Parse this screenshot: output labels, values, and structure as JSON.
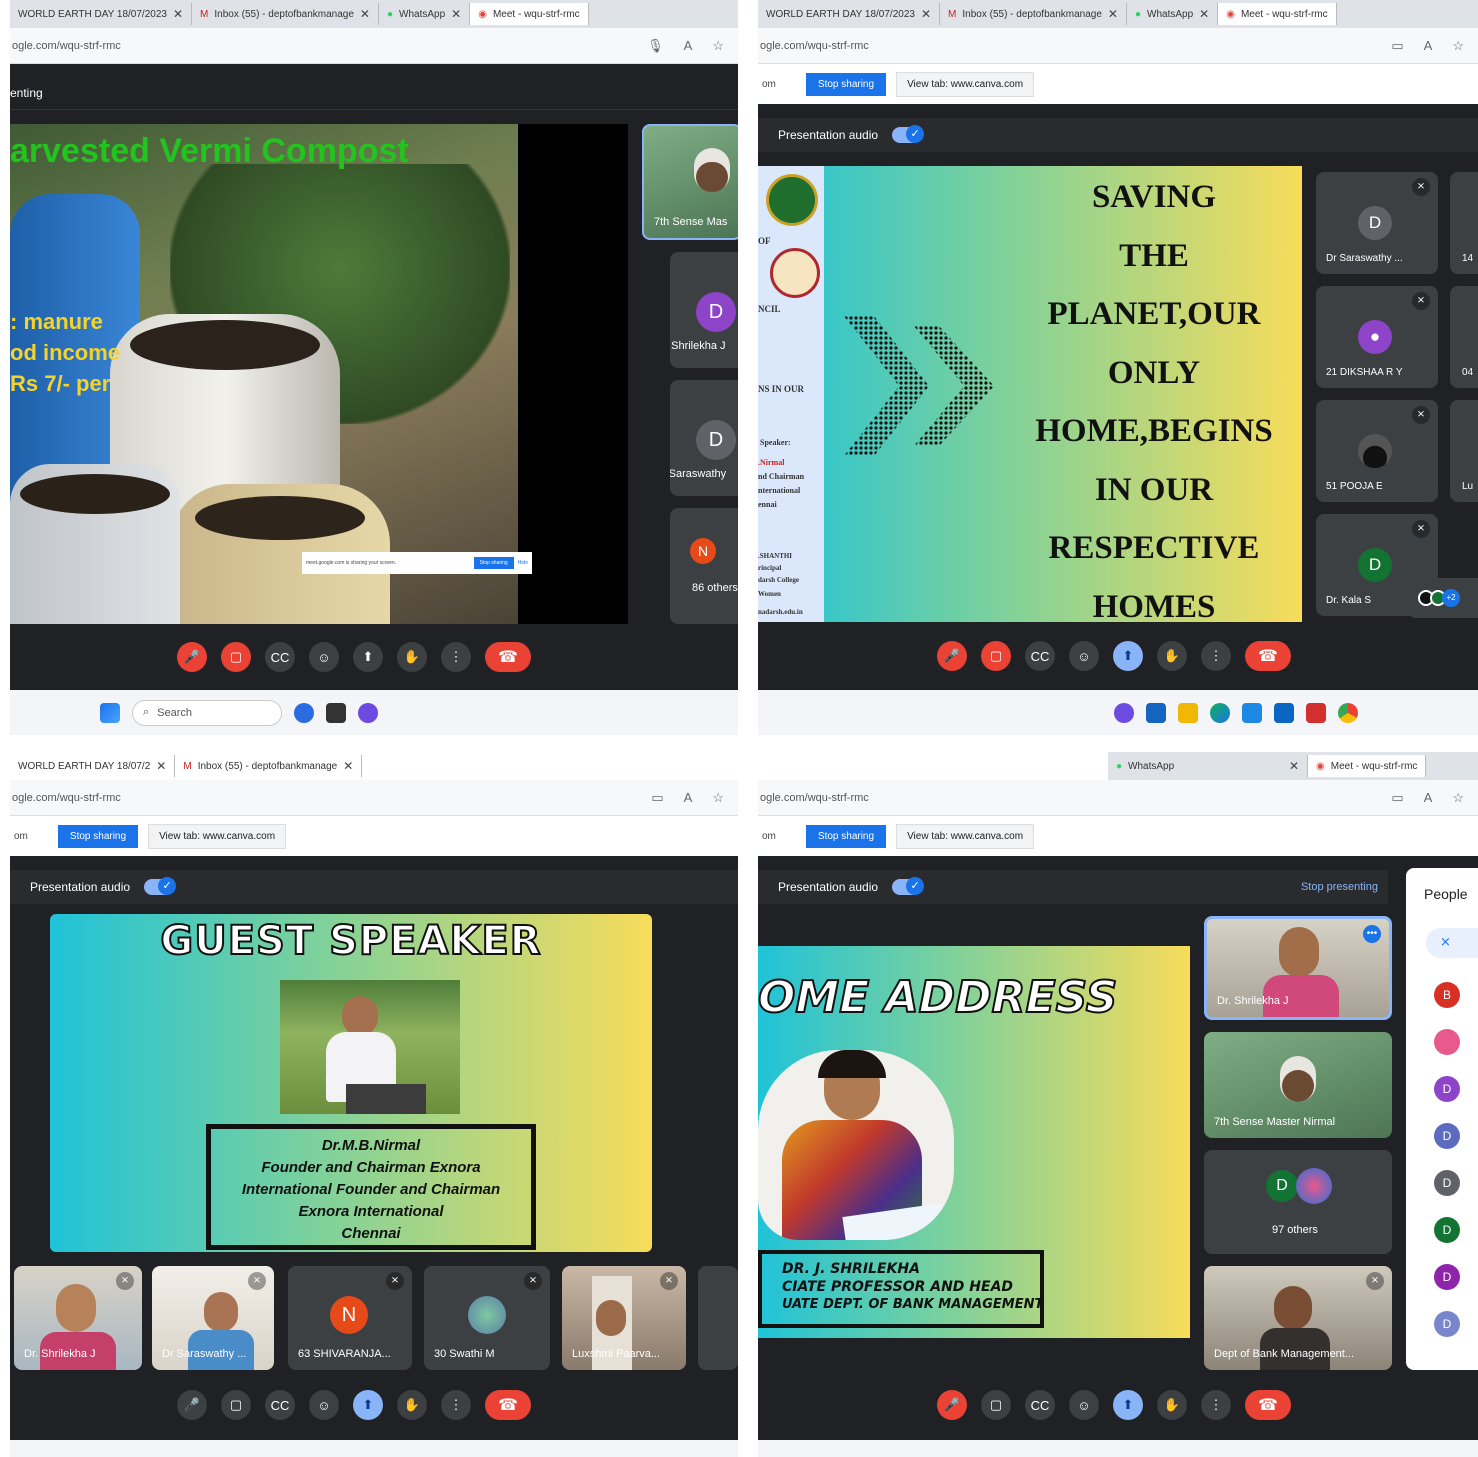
{
  "q1": {
    "tabs": [
      {
        "label": "WORLD EARTH DAY 18/07/2023"
      },
      {
        "label": "Inbox (55) - deptofbankmanage"
      },
      {
        "label": "WhatsApp"
      },
      {
        "label": "Meet - wqu-strf-rmc"
      }
    ],
    "url": "ogle.com/wqu-strf-rmc",
    "presenting_label": "enting",
    "slide_title": "arvested Vermi Compost",
    "slide_lines": [
      ": manure",
      "od income",
      "Rs 7/- per"
    ],
    "sharing_popup": "meet.google.com is sharing your screen.",
    "sharing_popup_stop": "Stop sharing",
    "sharing_popup_hide": "Hide",
    "tiles": [
      {
        "name": "7th Sense Mas"
      },
      {
        "name": "Dr. Shrilekha J",
        "initial": "D",
        "color": "#8e44c9"
      },
      {
        "name": "Dr Saraswathy",
        "initial": "D",
        "color": "#5f6368"
      },
      {
        "name": "86 others",
        "initial": "N",
        "color": "#e64a19"
      }
    ],
    "search_placeholder": "Search"
  },
  "q2": {
    "tabs": [
      {
        "label": "WORLD EARTH DAY 18/07/2023"
      },
      {
        "label": "Inbox (55) - deptofbankmanage"
      },
      {
        "label": "WhatsApp"
      },
      {
        "label": "Meet - wqu-strf-rmc"
      }
    ],
    "url": "ogle.com/wqu-strf-rmc",
    "share_prefix": "om",
    "stop_sharing": "Stop sharing",
    "view_tab": "View tab: www.canva.com",
    "presentation_audio": "Presentation audio",
    "sidebar_text": [
      "OF",
      "NCIL",
      "NS IN OUR",
      "Speaker:",
      ".Nirmal",
      "nd Chairman",
      "nternational",
      "ennai",
      ".SHANTHI",
      "rincipal",
      "darsh College",
      "Women",
      "nadarsh.edu.in"
    ],
    "slide_lines": [
      "SAVING",
      "THE",
      "PLANET,OUR",
      "ONLY",
      "HOME,BEGINS",
      "IN OUR",
      "RESPECTIVE",
      "HOMES"
    ],
    "tiles": [
      {
        "name": "Dr Saraswathy ...",
        "initial": "D",
        "color": "#5f6368"
      },
      {
        "name": "14"
      },
      {
        "name": "21 DIKSHAA R Y",
        "color": "#8e44c9"
      },
      {
        "name": "04"
      },
      {
        "name": "51 POOJA E"
      },
      {
        "name": "Lu"
      },
      {
        "name": "Dr. Kala S",
        "initial": "D",
        "color": "#137333"
      },
      {
        "name": "+2"
      }
    ]
  },
  "q3": {
    "tabs": [
      {
        "label": "WORLD EARTH DAY 18/07/2"
      },
      {
        "label": "Inbox (55) - deptofbankmanage"
      }
    ],
    "url": "ogle.com/wqu-strf-rmc",
    "share_prefix": "om",
    "stop_sharing": "Stop sharing",
    "view_tab": "View tab: www.canva.com",
    "presentation_audio": "Presentation audio",
    "slide_title": "GUEST SPEAKER",
    "caption_lines": [
      "Dr.M.B.Nirmal",
      "Founder and Chairman Exnora",
      "International Founder and Chairman",
      "Exnora International",
      "Chennai"
    ],
    "tiles": [
      {
        "name": "Dr. Shrilekha J"
      },
      {
        "name": "Dr Saraswathy ..."
      },
      {
        "name": "63 SHIVARANJA...",
        "initial": "N",
        "color": "#e64a19"
      },
      {
        "name": "30 Swathi M"
      },
      {
        "name": "Luxshmi Paarva..."
      }
    ]
  },
  "q4": {
    "tabs": [
      {
        "label": "WhatsApp"
      },
      {
        "label": "Meet - wqu-strf-rmc"
      }
    ],
    "url": "ogle.com/wqu-strf-rmc",
    "share_prefix": "om",
    "stop_sharing": "Stop sharing",
    "view_tab": "View tab: www.canva.com",
    "presentation_audio": "Presentation audio",
    "stop_presenting": "Stop presenting",
    "slide_title": "OME ADDRESS",
    "caption_lines": [
      "DR. J. SHRILEKHA",
      "CIATE PROFESSOR AND HEAD",
      "UATE DEPT. OF BANK MANAGEMENT"
    ],
    "tiles": [
      {
        "name": "Dr. Shrilekha J"
      },
      {
        "name": "7th Sense Master Nirmal"
      },
      {
        "name": "97 others",
        "initial": "D",
        "color": "#137333"
      },
      {
        "name": "Dept of Bank Management..."
      }
    ],
    "people_title": "People",
    "people_initials": [
      {
        "initial": "B",
        "color": "#d93025"
      },
      {
        "initial": "",
        "color": "#e8598c"
      },
      {
        "initial": "D",
        "color": "#8e44c9"
      },
      {
        "initial": "D",
        "color": "#5c6bc0"
      },
      {
        "initial": "D",
        "color": "#5f6368"
      },
      {
        "initial": "D",
        "color": "#137333"
      },
      {
        "initial": "D",
        "color": "#8e24aa"
      },
      {
        "initial": "D",
        "color": "#7986cb"
      }
    ]
  }
}
